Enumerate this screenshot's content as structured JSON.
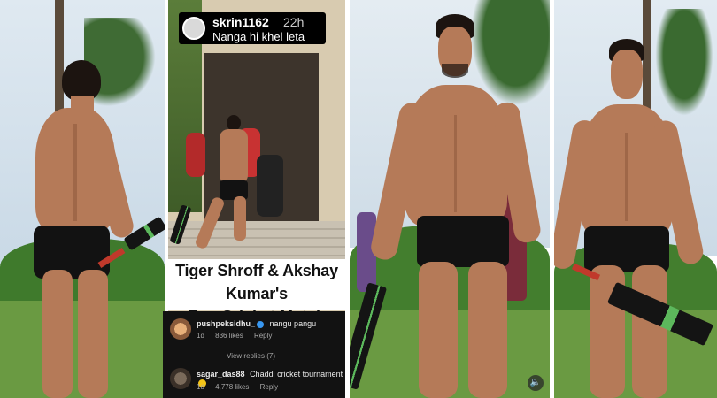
{
  "image": {
    "description_panels": 4
  },
  "top_comment": {
    "username": "skrin1162",
    "time": "22h",
    "text": "Nanga hi khel leta"
  },
  "title": {
    "line1": "Tiger Shroff & Akshay Kumar's",
    "line2": "Fun Cricket Match"
  },
  "comments": [
    {
      "username": "pushpeksidhu_",
      "text": "nangu pangu",
      "age": "1d",
      "likes": "836 likes",
      "reply": "Reply"
    },
    {
      "username": "sagar_das88",
      "text": "Chaddi cricket tournament",
      "age": "1d",
      "likes": "4,778 likes",
      "reply": "Reply"
    }
  ],
  "view_replies": "View replies (7)",
  "colors": {
    "sky": "#cfe0ec",
    "grass": "#5f8f3a",
    "hedge": "#3f7a2c",
    "skin": "#b57a58",
    "shorts": "#121212",
    "comment_bg": "#121212",
    "verified": "#3897f0"
  },
  "icons": {
    "mute": "speaker-mute-icon"
  }
}
